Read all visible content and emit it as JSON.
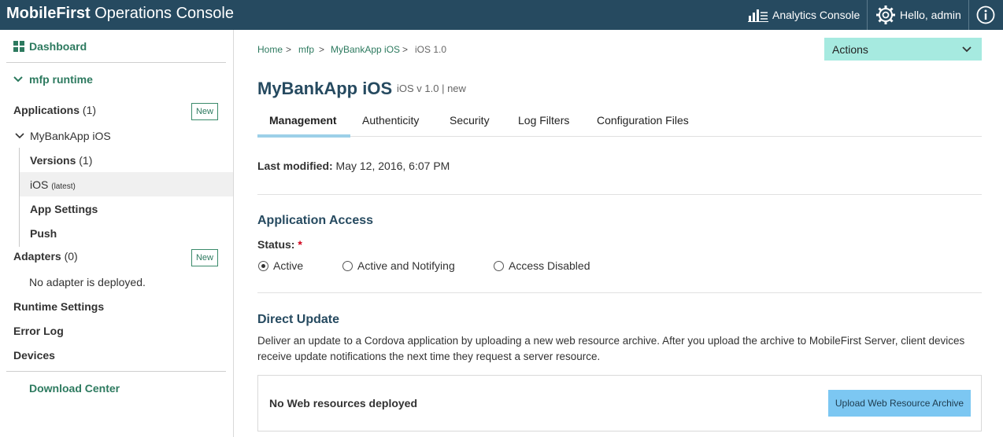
{
  "header": {
    "brand_bold": "MobileFirst",
    "brand_rest": " Operations Console",
    "analytics_label": "Analytics Console",
    "user_label": "Hello, admin"
  },
  "sidebar": {
    "dashboard": "Dashboard",
    "runtime": "mfp runtime",
    "applications_label": "Applications",
    "applications_count": "(1)",
    "new_label": "New",
    "app_name": "MyBankApp iOS",
    "versions_label": "Versions",
    "versions_count": "(1)",
    "ios_label": "iOS",
    "ios_tag": "(latest)",
    "app_settings": "App Settings",
    "push": "Push",
    "adapters_label": "Adapters",
    "adapters_count": "(0)",
    "no_adapter": "No adapter is deployed.",
    "runtime_settings": "Runtime Settings",
    "error_log": "Error Log",
    "devices": "Devices",
    "download_center": "Download Center"
  },
  "breadcrumb": {
    "home": "Home",
    "mfp": "mfp",
    "app": "MyBankApp iOS",
    "current": "iOS 1.0",
    "sep": ">"
  },
  "actions_label": "Actions",
  "page": {
    "title": "MyBankApp iOS",
    "subtitle": "iOS v 1.0 | new"
  },
  "tabs": [
    {
      "label": "Management",
      "active": true
    },
    {
      "label": "Authenticity"
    },
    {
      "label": "Security"
    },
    {
      "label": "Log Filters"
    },
    {
      "label": "Configuration Files"
    }
  ],
  "last_modified": {
    "label": "Last modified:",
    "value": " May 12, 2016, 6:07 PM"
  },
  "access": {
    "heading": "Application Access",
    "status_label": "Status:",
    "required_mark": "*",
    "options": [
      "Active",
      "Active and Notifying",
      "Access Disabled"
    ],
    "selected": "Active"
  },
  "direct_update": {
    "heading": "Direct Update",
    "description": "Deliver an update to a Cordova application by uploading a new web resource archive. After you upload the archive to MobileFirst Server, client devices receive update notifications the next time they request a server resource.",
    "no_resources": "No Web resources deployed",
    "upload_label": "Upload Web Resource Archive"
  },
  "colors": {
    "header_bg": "#264a60",
    "accent_green": "#2d7a5f",
    "actions_bg": "#a6eae0",
    "upload_bg": "#7cc7f2"
  }
}
